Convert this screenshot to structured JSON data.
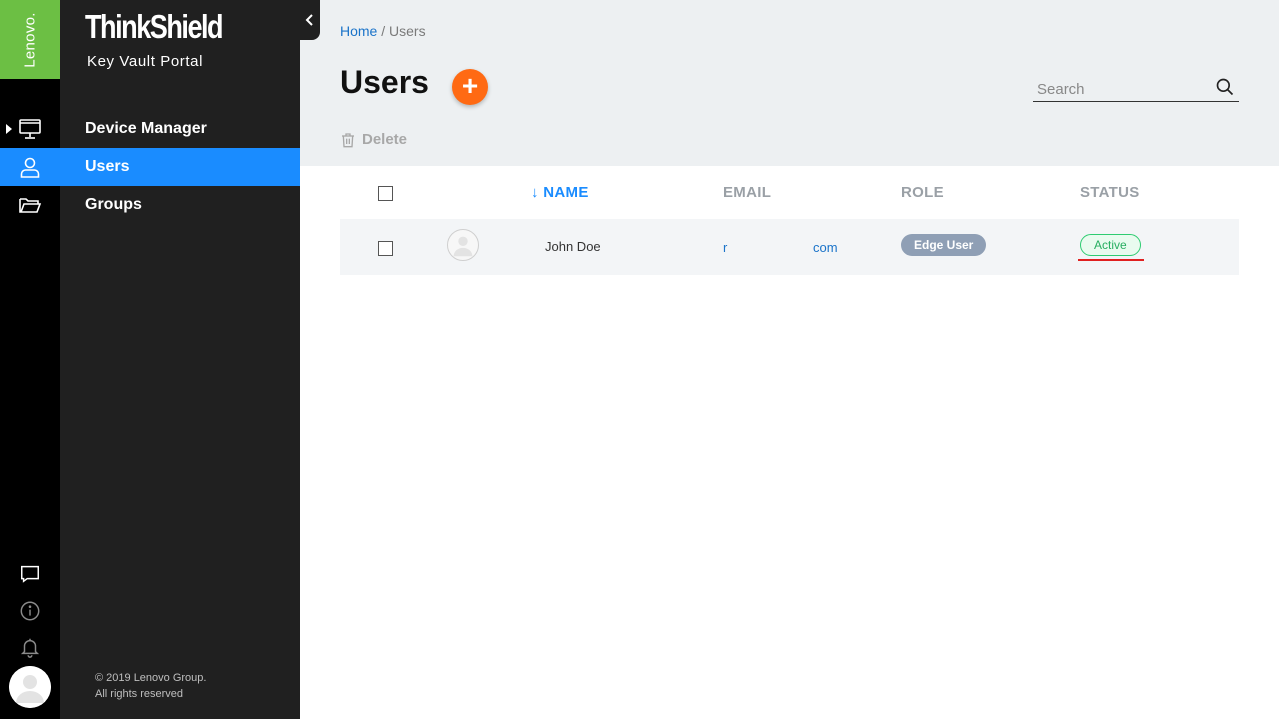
{
  "brand": {
    "vendor": "Lenovo.",
    "product": "ThinkShield",
    "portal": "Key Vault Portal",
    "accent": "#1a8cff",
    "vendor_color": "#6cbf44"
  },
  "rail": {
    "items": [
      {
        "icon": "monitor-icon"
      },
      {
        "icon": "user-icon"
      },
      {
        "icon": "folder-icon"
      }
    ],
    "bottom": [
      {
        "icon": "chat-icon"
      },
      {
        "icon": "info-icon"
      },
      {
        "icon": "bell-icon"
      }
    ]
  },
  "sidebar": {
    "items": [
      {
        "label": "Device Manager"
      },
      {
        "label": "Users"
      },
      {
        "label": "Groups"
      }
    ],
    "copyright_line1": "© 2019 Lenovo Group.",
    "copyright_line2": "All rights reserved"
  },
  "breadcrumb": {
    "home": "Home",
    "separator": " / ",
    "current": "Users"
  },
  "page": {
    "title": "Users",
    "add_icon": "+",
    "search_placeholder": "Search",
    "delete_label": "Delete",
    "add_color": "#ff6a13"
  },
  "table": {
    "columns": {
      "name": "NAME",
      "email": "EMAIL",
      "role": "ROLE",
      "status": "STATUS"
    },
    "sort_indicator": "↓",
    "rows": [
      {
        "name": "John Doe",
        "email_start": "r",
        "email_end": "com",
        "role": "Edge User",
        "status": "Active"
      }
    ]
  }
}
